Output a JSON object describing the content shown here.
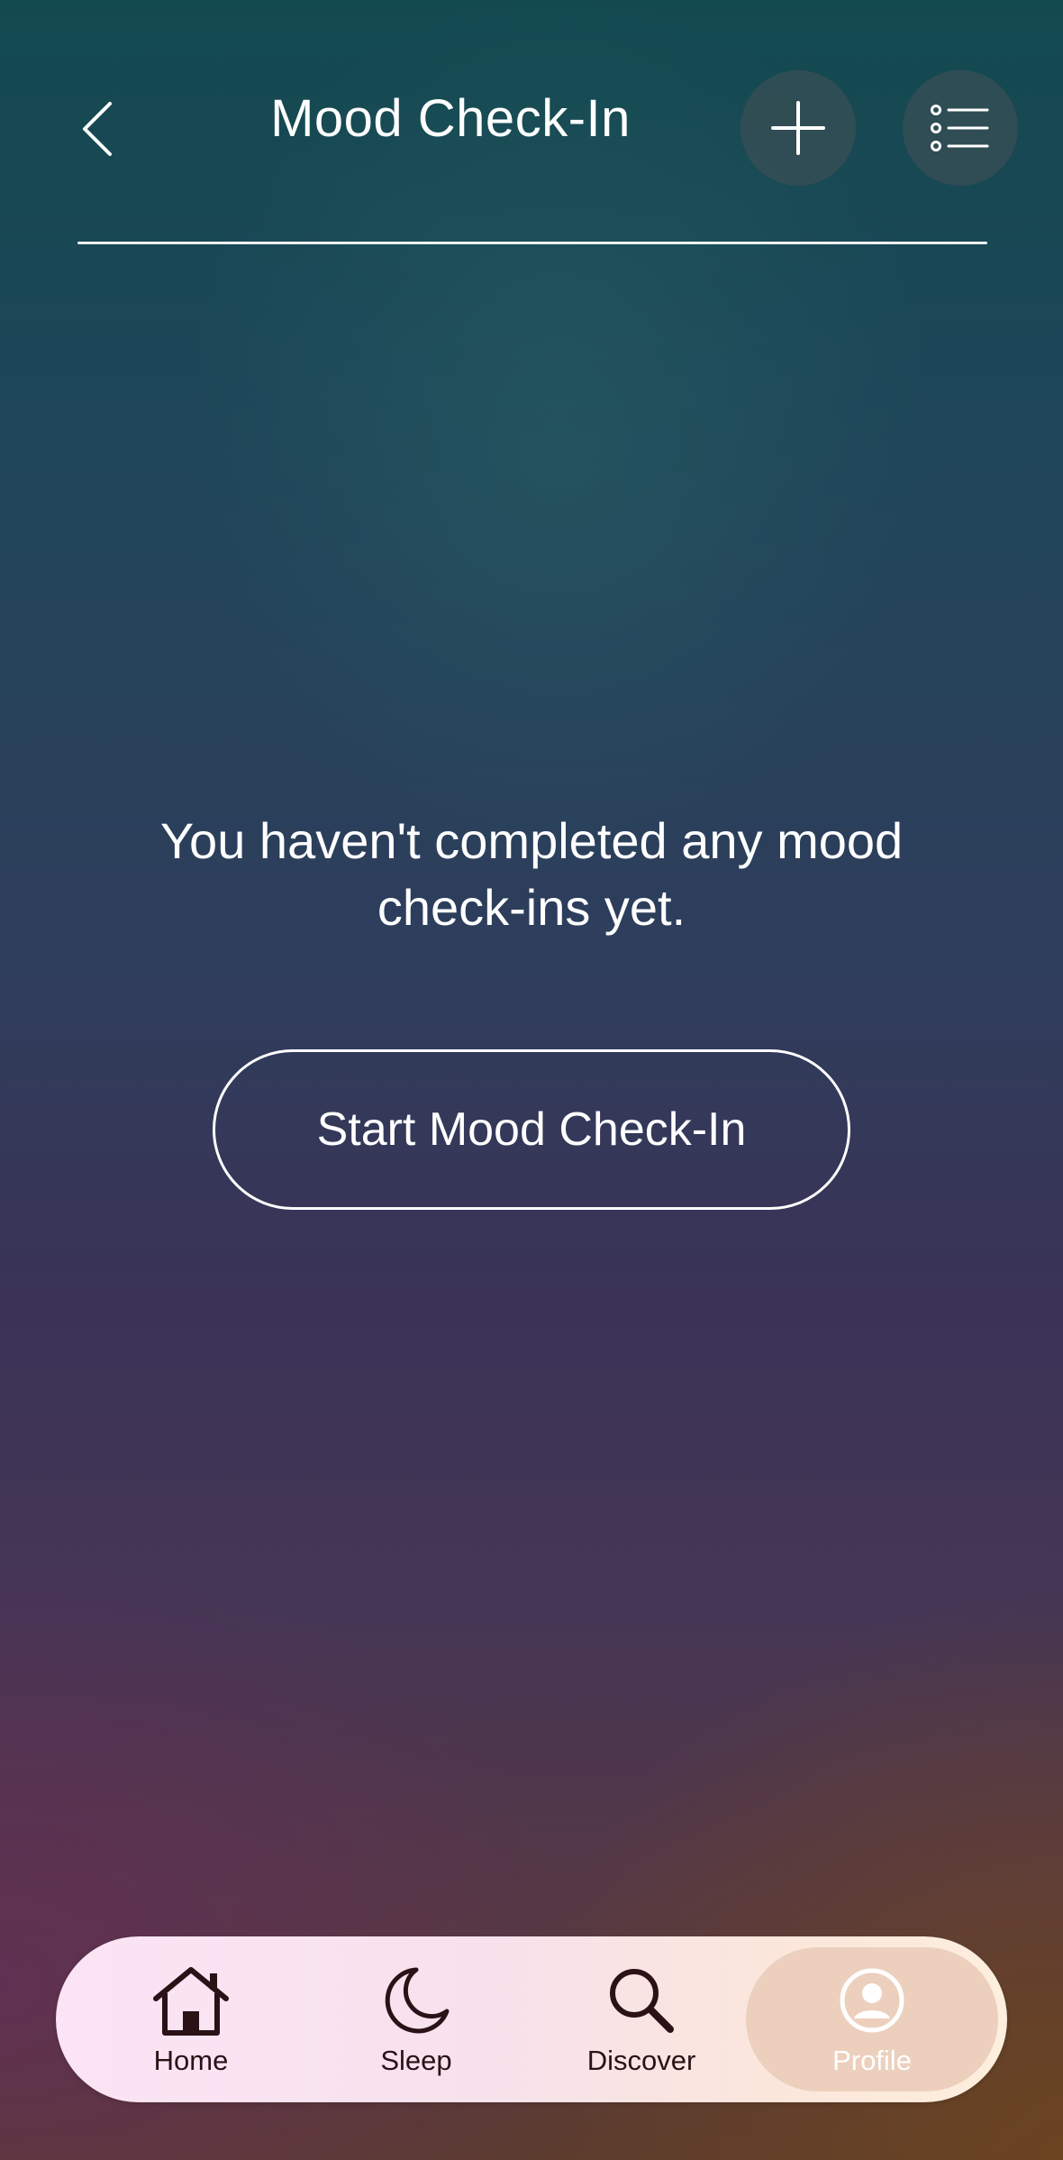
{
  "header": {
    "title": "Mood Check-In",
    "back_icon": "chevron-left-icon",
    "add_icon": "plus-icon",
    "list_icon": "list-icon"
  },
  "empty_state": {
    "message": "You haven't completed any mood check-ins yet.",
    "start_button_label": "Start Mood Check-In"
  },
  "bottom_nav": {
    "items": [
      {
        "label": "Home",
        "icon": "home-icon"
      },
      {
        "label": "Sleep",
        "icon": "moon-icon"
      },
      {
        "label": "Discover",
        "icon": "search-icon"
      },
      {
        "label": "Profile",
        "icon": "profile-icon",
        "selected": true
      }
    ]
  },
  "colors": {
    "text": "#ffffff",
    "nav_background": "#f9e4ec",
    "nav_selected": "#ecd0bd",
    "nav_text": "#2a1216"
  }
}
